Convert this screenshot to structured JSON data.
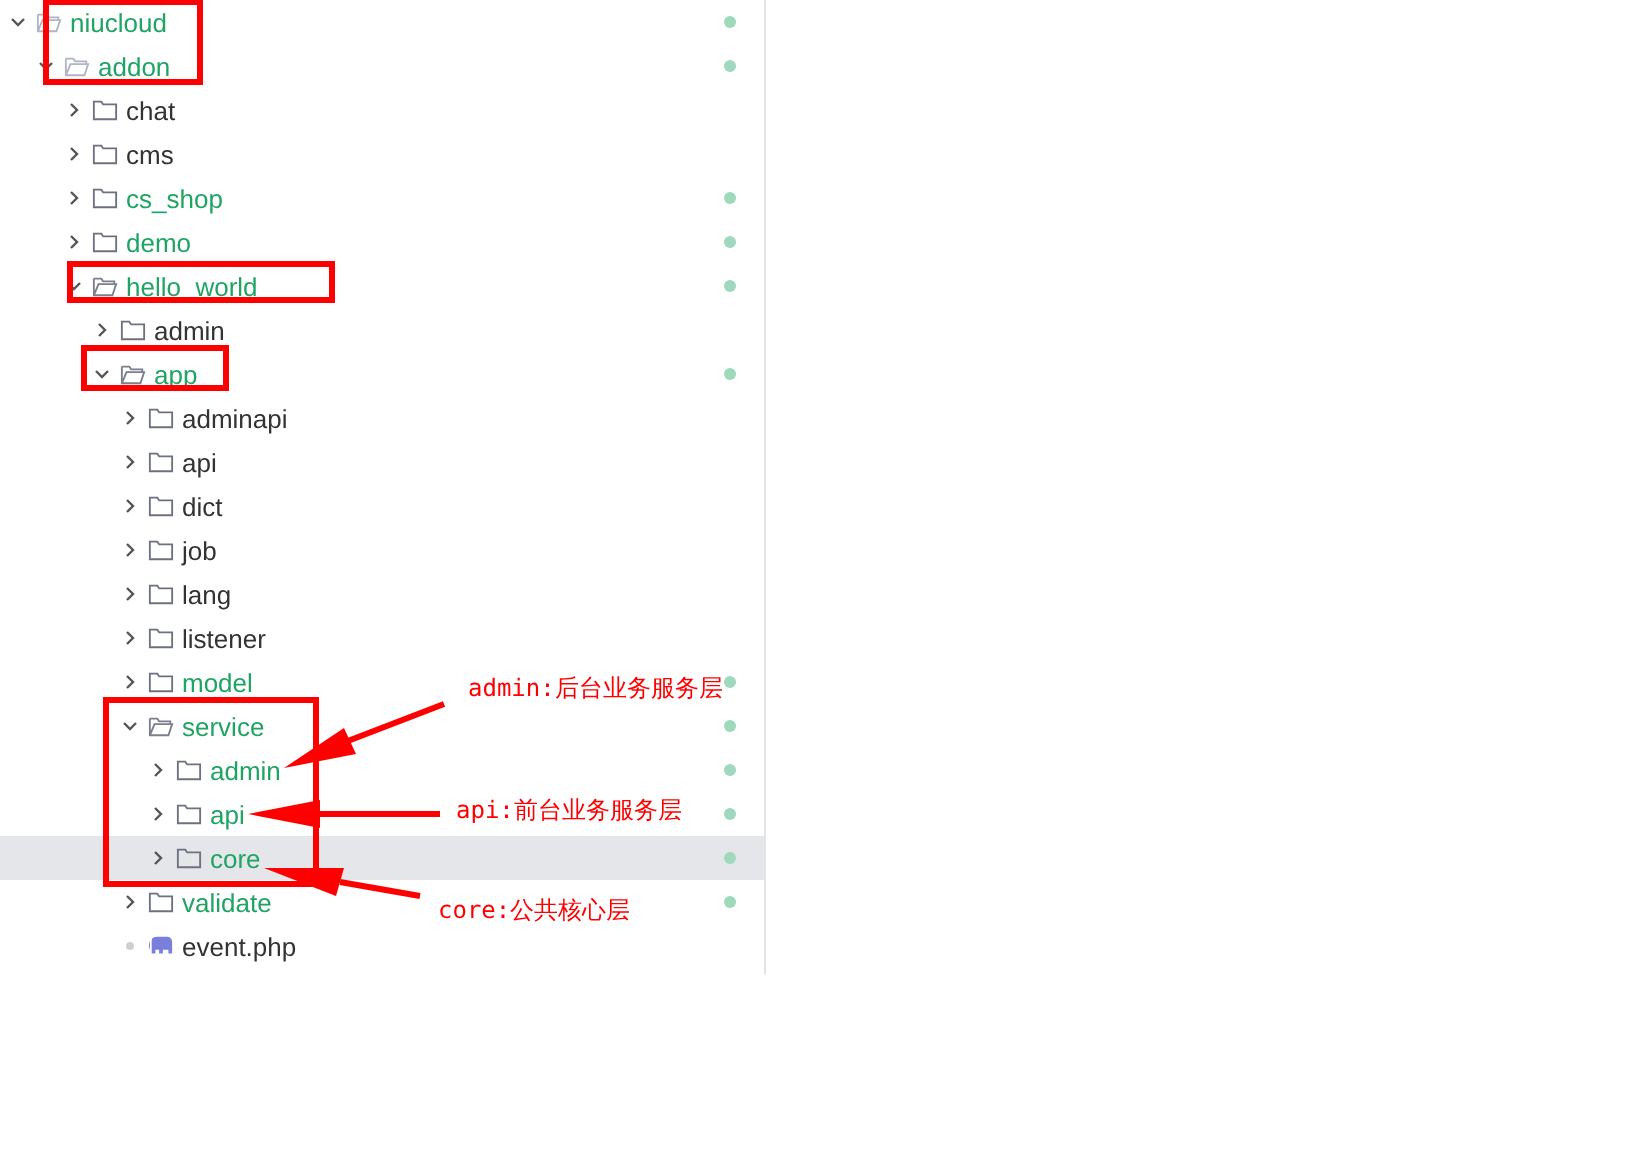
{
  "tree": [
    {
      "name": "niucloud",
      "kind": "folder",
      "expanded": true,
      "modified": true,
      "selected": false,
      "children": [
        {
          "name": "addon",
          "kind": "folder",
          "expanded": true,
          "modified": true,
          "selected": false,
          "children": [
            {
              "name": "chat",
              "kind": "folder",
              "expanded": false,
              "modified": false,
              "selected": false
            },
            {
              "name": "cms",
              "kind": "folder",
              "expanded": false,
              "modified": false,
              "selected": false
            },
            {
              "name": "cs_shop",
              "kind": "folder",
              "expanded": false,
              "modified": true,
              "selected": false
            },
            {
              "name": "demo",
              "kind": "folder",
              "expanded": false,
              "modified": true,
              "selected": false
            },
            {
              "name": "hello_world",
              "kind": "folder",
              "expanded": true,
              "modified": true,
              "selected": false,
              "children": [
                {
                  "name": "admin",
                  "kind": "folder",
                  "expanded": false,
                  "modified": false,
                  "selected": false
                },
                {
                  "name": "app",
                  "kind": "folder",
                  "expanded": true,
                  "modified": true,
                  "selected": false,
                  "children": [
                    {
                      "name": "adminapi",
                      "kind": "folder",
                      "expanded": false,
                      "modified": false,
                      "selected": false
                    },
                    {
                      "name": "api",
                      "kind": "folder",
                      "expanded": false,
                      "modified": false,
                      "selected": false
                    },
                    {
                      "name": "dict",
                      "kind": "folder",
                      "expanded": false,
                      "modified": false,
                      "selected": false
                    },
                    {
                      "name": "job",
                      "kind": "folder",
                      "expanded": false,
                      "modified": false,
                      "selected": false
                    },
                    {
                      "name": "lang",
                      "kind": "folder",
                      "expanded": false,
                      "modified": false,
                      "selected": false
                    },
                    {
                      "name": "listener",
                      "kind": "folder",
                      "expanded": false,
                      "modified": false,
                      "selected": false
                    },
                    {
                      "name": "model",
                      "kind": "folder",
                      "expanded": false,
                      "modified": true,
                      "selected": false
                    },
                    {
                      "name": "service",
                      "kind": "folder",
                      "expanded": true,
                      "modified": true,
                      "selected": false,
                      "children": [
                        {
                          "name": "admin",
                          "kind": "folder",
                          "expanded": false,
                          "modified": true,
                          "selected": false
                        },
                        {
                          "name": "api",
                          "kind": "folder",
                          "expanded": false,
                          "modified": true,
                          "selected": false
                        },
                        {
                          "name": "core",
                          "kind": "folder",
                          "expanded": false,
                          "modified": true,
                          "selected": true
                        }
                      ]
                    },
                    {
                      "name": "validate",
                      "kind": "folder",
                      "expanded": false,
                      "modified": true,
                      "selected": false
                    },
                    {
                      "name": "event.php",
                      "kind": "php",
                      "modified": false,
                      "selected": false
                    }
                  ]
                }
              ]
            }
          ]
        }
      ]
    }
  ],
  "annotations": [
    {
      "text": "admin:后台业务服务层"
    },
    {
      "text": "api:前台业务服务层"
    },
    {
      "text": "core:公共核心层"
    }
  ]
}
